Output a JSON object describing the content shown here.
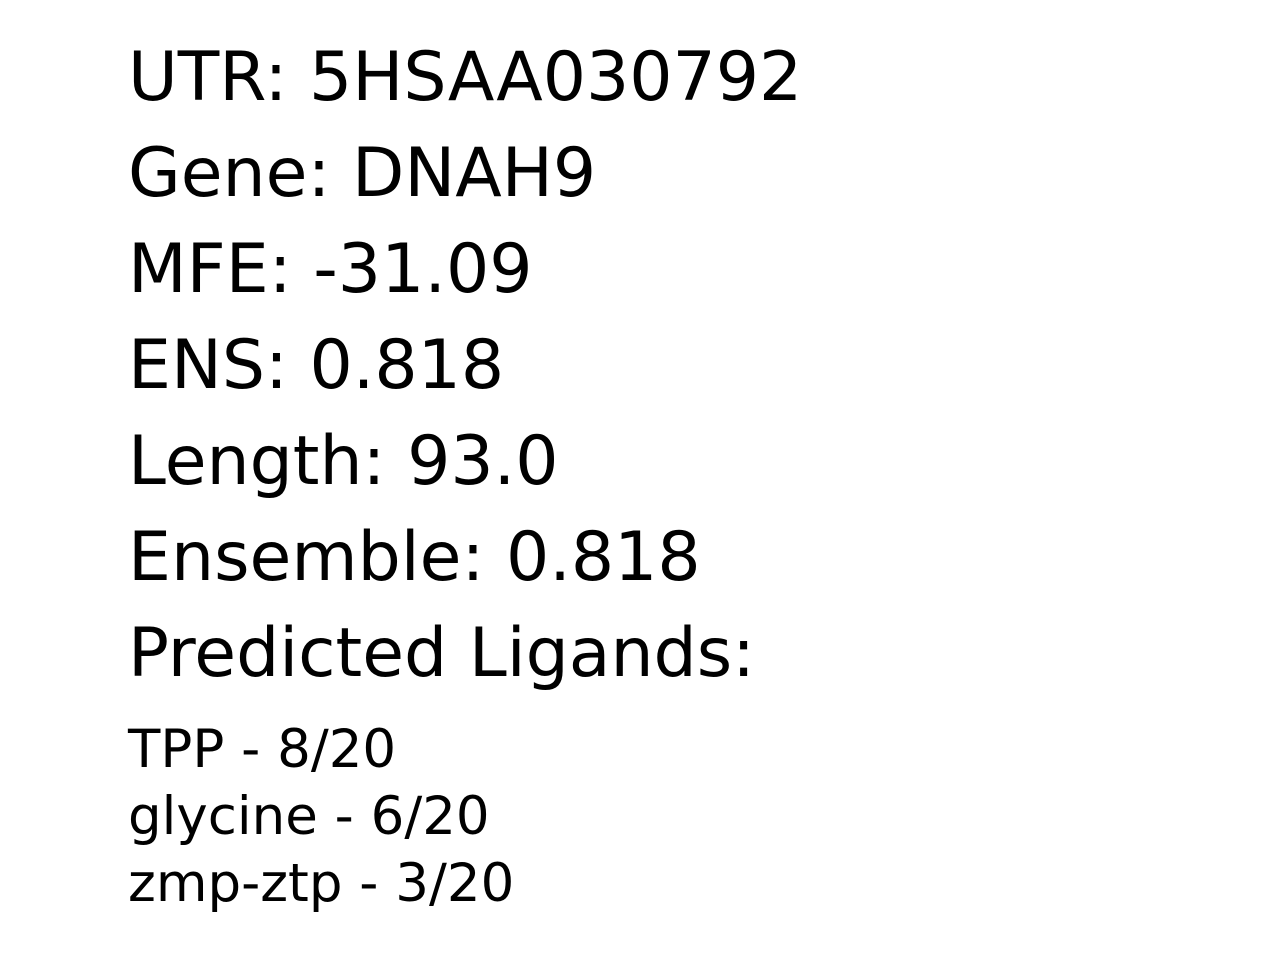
{
  "record": {
    "utr": "UTR: 5HSAA030792",
    "gene": "Gene: DNAH9",
    "mfe": "MFE: -31.09",
    "ens": "ENS: 0.818",
    "length": "Length: 93.0",
    "ensemble": "Ensemble: 0.818",
    "ligands_heading": "Predicted Ligands:"
  },
  "ligands": [
    "TPP - 8/20",
    "glycine - 6/20",
    "zmp-ztp - 3/20"
  ]
}
